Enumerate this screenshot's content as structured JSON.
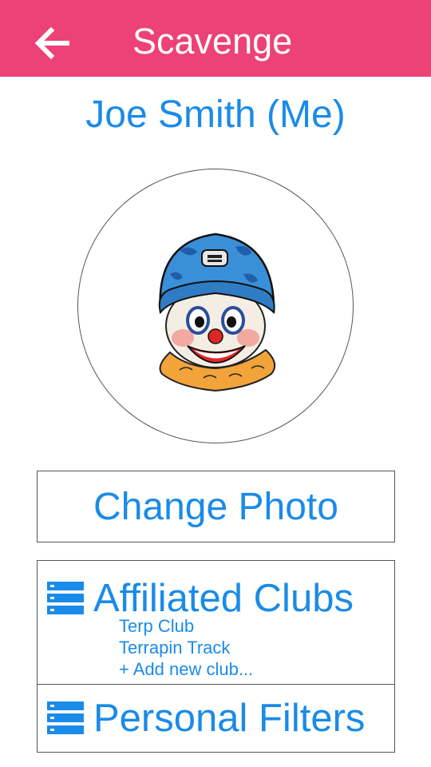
{
  "appbar": {
    "title": "Scavenge",
    "back_icon": "arrow-back-icon",
    "background_color": "#ec4277"
  },
  "profile": {
    "name": "Joe Smith (Me)",
    "avatar_icon": "clown-avatar"
  },
  "change_photo": {
    "label": "Change Photo"
  },
  "affiliated_clubs": {
    "icon": "list-icon",
    "label": "Affiliated Clubs",
    "items": [
      "Terp Club",
      "Terrapin Track"
    ],
    "add_label": "+ Add new club..."
  },
  "personal_filters": {
    "icon": "list-icon",
    "label": "Personal Filters"
  },
  "colors": {
    "accent": "#1a8be8",
    "border": "#555555"
  }
}
